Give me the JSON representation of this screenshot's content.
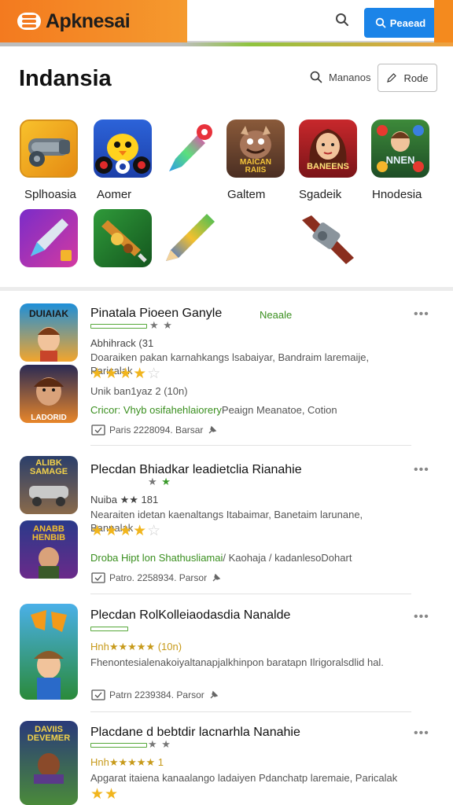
{
  "header": {
    "brand": "Apknesai",
    "search_icon": "search-icon",
    "primary_button": "Peaead",
    "accent": "#f37a1f",
    "button_color": "#1b84e8"
  },
  "section": {
    "title": "Indansia",
    "search_label": "Mananos",
    "outline_button": "Rode"
  },
  "categories": [
    {
      "label": "Splhoasia"
    },
    {
      "label": "Aomer"
    },
    {
      "label": "Galtem"
    },
    {
      "label": "Sgadeik"
    },
    {
      "label": "Hnodesia"
    }
  ],
  "category_tiles": [
    {
      "icon": "cannon-icon",
      "text": ""
    },
    {
      "icon": "bird-character-icon",
      "text": ""
    },
    {
      "icon": "rocket-pencil-icon",
      "text": ""
    },
    {
      "icon": "monster-icon",
      "text": "MAICAN RAIIS"
    },
    {
      "icon": "heroine-icon",
      "text": "BANEENS"
    },
    {
      "icon": "puzzle-game-icon",
      "text": "NNEN"
    },
    {
      "icon": "rocket-icon",
      "text": ""
    },
    {
      "icon": "blaster-icon",
      "text": ""
    },
    {
      "icon": "pencil-icon",
      "text": ""
    },
    {
      "icon": "cannon-icon",
      "text": ""
    }
  ],
  "listings": [
    {
      "title": "Pinatala Pioeen Ganyle",
      "badge": "Neaale",
      "thumb_top_text": "DUIAIAK",
      "thumb_bottom_text": "LADORID",
      "meta": "Abhihrack (31",
      "desc": "Doaraiken pakan karnahkangs lsabaiyar, Bandraim laremaije, Paricalak",
      "stars": "★★★★",
      "stars_empty": "☆",
      "count": "Unik ban1yaz 2 (10n)",
      "link_green": "Cricor: Vhyb osifahehlaiorery",
      "link_rest": "Peaign Meanatoe, Cotion",
      "info": "Paris 2228094. Barsar",
      "more": "•••"
    },
    {
      "title": "Plecdan Bhiadkar leadietclia Rianahie",
      "badge": "",
      "thumb_top_text": "ALIBK SAMAGE",
      "thumb_bottom_text": "ANABB HENBIB",
      "meta": "Nuiba ★★ 181",
      "desc": "Nearaiten idetan kaenaltangs Itabaimar, Banetaim larunane, Bannalak",
      "stars": "★★★★",
      "stars_empty": "☆",
      "count": "",
      "link_green": "Droba Hipt lon Shathusliamai",
      "link_rest": "/ Kaohaja / kadanlesoDohart",
      "info": "Patro. 2258934. Parsor",
      "more": "•••"
    },
    {
      "title": "Plecdan RolKolleiaodasdia Nanalde",
      "badge": "",
      "thumb_top_text": "",
      "thumb_bottom_text": "",
      "meta": "Hnh★★★★★ (10n)",
      "desc": "Fhenontesialenakoiyaltanapjalkhinpon baratapn Ilrigoralsdlid hal.",
      "stars": "",
      "stars_empty": "",
      "count": "",
      "link_green": "",
      "link_rest": "",
      "info": "Patrn 2239384. Parsor",
      "more": "•••"
    },
    {
      "title": "Placdane d bebtdir lacnarhla Nanahie",
      "badge": "",
      "thumb_top_text": "DAVIIS DEVEMER",
      "thumb_bottom_text": "",
      "meta": "Hnh★★★★★ 1",
      "desc": "Apgarat itaiena kanaalango ladaiyen Pdanchatp laremaie, Paricalak",
      "stars": "★★",
      "stars_empty": "",
      "count": "",
      "link_green": "",
      "link_rest": "",
      "info": "",
      "more": "•••"
    }
  ]
}
